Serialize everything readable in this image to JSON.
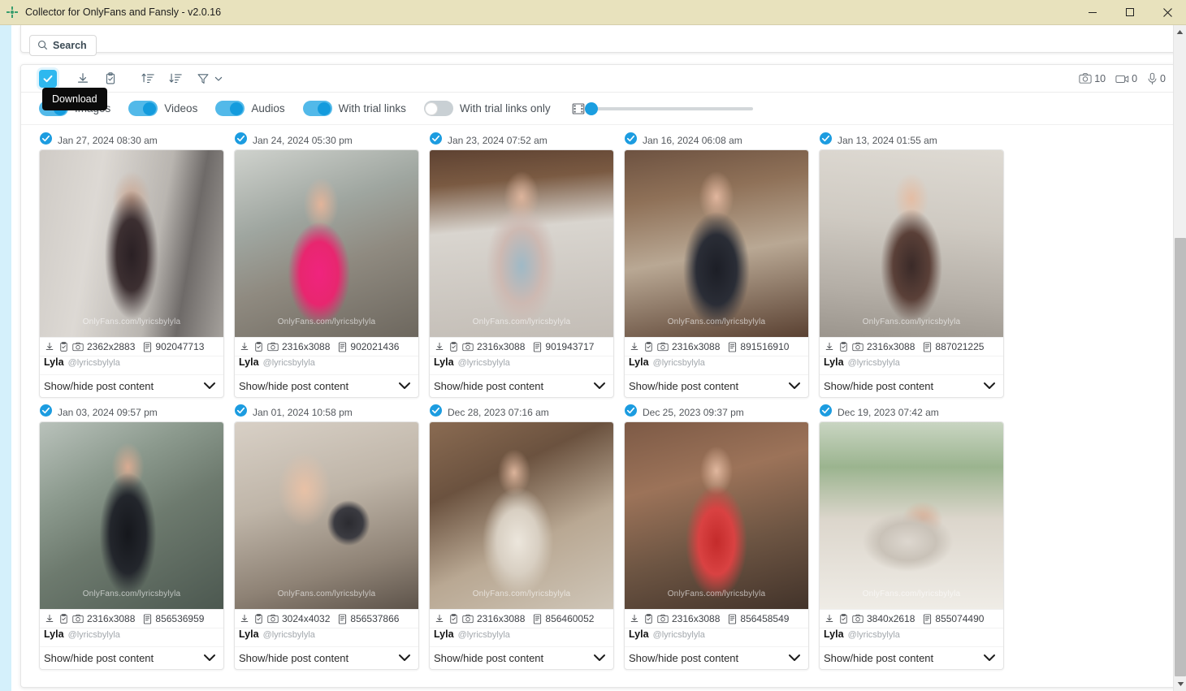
{
  "window": {
    "title": "Collector for OnlyFans and Fansly - v2.0.16",
    "minimize_label": "Minimize",
    "maximize_label": "Maximize",
    "close_label": "Close"
  },
  "search": {
    "button_label": "Search"
  },
  "toolbar": {
    "select_all_name": "select-all",
    "download_label": "Download",
    "tooltip": "Download",
    "icons": [
      {
        "name": "select-all-checkbox",
        "label": "Select all"
      },
      {
        "name": "download-icon",
        "label": "Download"
      },
      {
        "name": "clipboard-check-icon",
        "label": "Copy to clipboard"
      },
      {
        "name": "sort-ascending-icon",
        "label": "Sort ascending"
      },
      {
        "name": "sort-descending-icon",
        "label": "Sort descending"
      },
      {
        "name": "filter-icon",
        "label": "Filter"
      }
    ],
    "counters": {
      "photos": "10",
      "videos": "0",
      "audios": "0"
    }
  },
  "filters": {
    "toggles": [
      {
        "name": "images",
        "label": "Images",
        "on": true
      },
      {
        "name": "videos",
        "label": "Videos",
        "on": true
      },
      {
        "name": "audios",
        "label": "Audios",
        "on": true
      },
      {
        "name": "with-trial-links",
        "label": "With trial links",
        "on": true
      },
      {
        "name": "with-trial-links-only",
        "label": "With trial links only",
        "on": false
      }
    ],
    "slider": {
      "name": "video-quality-slider",
      "value": 0
    }
  },
  "accent_colors": {
    "toggle_on": "#52b9e9",
    "toggle_knob": "#139bdd",
    "checkbox": "#2eb8ef",
    "titlebar": "#e8e2bd",
    "left_strip": "#d4f0fb"
  },
  "card_labels": {
    "show_hide": "Show/hide post content",
    "watermark": "OnlyFans.com/lyricsbylyla",
    "user_name": "Lyla",
    "user_handle": "@lyricsbylyla"
  },
  "posts": [
    {
      "date": "Jan 27, 2024 08:30 am",
      "dimensions": "2362x2883",
      "post_id": "902047713",
      "user_name": "Lyla",
      "user_handle": "@lyricsbylyla",
      "show_hide": "Show/hide post content",
      "selected": true,
      "photo": "ph1"
    },
    {
      "date": "Jan 24, 2024 05:30 pm",
      "dimensions": "2316x3088",
      "post_id": "902021436",
      "user_name": "Lyla",
      "user_handle": "@lyricsbylyla",
      "show_hide": "Show/hide post content",
      "selected": true,
      "photo": "ph2"
    },
    {
      "date": "Jan 23, 2024 07:52 am",
      "dimensions": "2316x3088",
      "post_id": "901943717",
      "user_name": "Lyla",
      "user_handle": "@lyricsbylyla",
      "show_hide": "Show/hide post content",
      "selected": true,
      "photo": "ph3"
    },
    {
      "date": "Jan 16, 2024 06:08 am",
      "dimensions": "2316x3088",
      "post_id": "891516910",
      "user_name": "Lyla",
      "user_handle": "@lyricsbylyla",
      "show_hide": "Show/hide post content",
      "selected": true,
      "photo": "ph4"
    },
    {
      "date": "Jan 13, 2024 01:55 am",
      "dimensions": "2316x3088",
      "post_id": "887021225",
      "user_name": "Lyla",
      "user_handle": "@lyricsbylyla",
      "show_hide": "Show/hide post content",
      "selected": true,
      "photo": "ph5"
    },
    {
      "date": "Jan 03, 2024 09:57 pm",
      "dimensions": "2316x3088",
      "post_id": "856536959",
      "user_name": "Lyla",
      "user_handle": "@lyricsbylyla",
      "show_hide": "Show/hide post content",
      "selected": true,
      "photo": "ph6"
    },
    {
      "date": "Jan 01, 2024 10:58 pm",
      "dimensions": "3024x4032",
      "post_id": "856537866",
      "user_name": "Lyla",
      "user_handle": "@lyricsbylyla",
      "show_hide": "Show/hide post content",
      "selected": true,
      "photo": "ph7"
    },
    {
      "date": "Dec 28, 2023 07:16 am",
      "dimensions": "2316x3088",
      "post_id": "856460052",
      "user_name": "Lyla",
      "user_handle": "@lyricsbylyla",
      "show_hide": "Show/hide post content",
      "selected": true,
      "photo": "ph8"
    },
    {
      "date": "Dec 25, 2023 09:37 pm",
      "dimensions": "2316x3088",
      "post_id": "856458549",
      "user_name": "Lyla",
      "user_handle": "@lyricsbylyla",
      "show_hide": "Show/hide post content",
      "selected": true,
      "photo": "ph9"
    },
    {
      "date": "Dec 19, 2023 07:42 am",
      "dimensions": "3840x2618",
      "post_id": "855074490",
      "user_name": "Lyla",
      "user_handle": "@lyricsbylyla",
      "show_hide": "Show/hide post content",
      "selected": true,
      "photo": "ph10"
    }
  ]
}
